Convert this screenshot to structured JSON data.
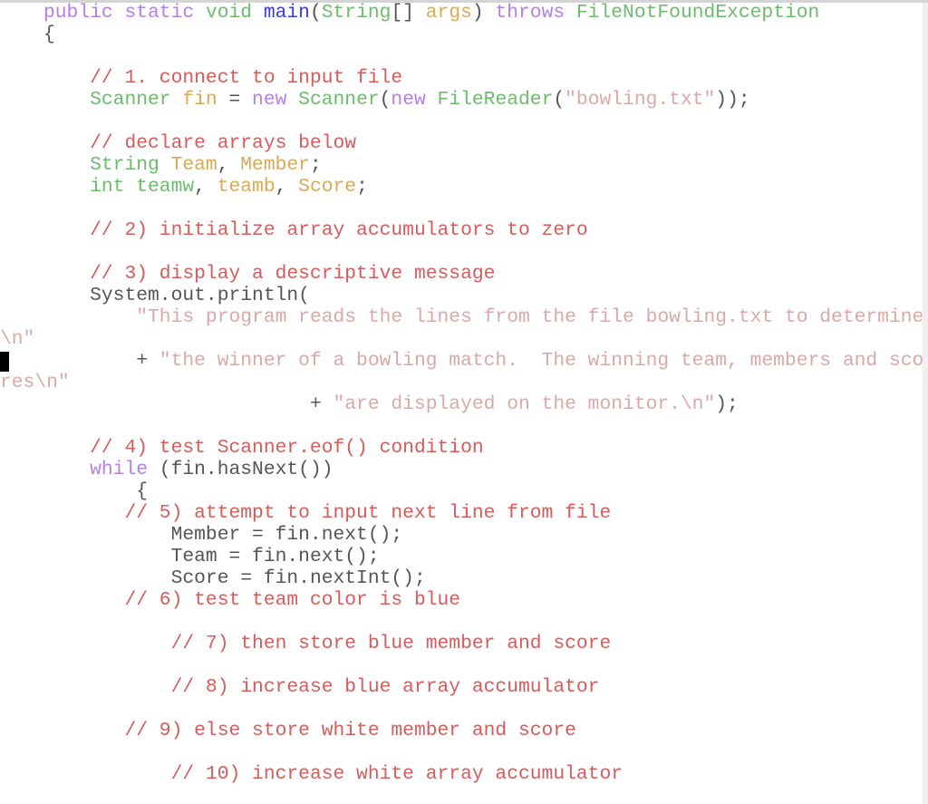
{
  "colors": {
    "keyword": "#b77fe6",
    "type": "#6dbb6d",
    "identifier": "#d8aa55",
    "method": "#3a3ae6",
    "comment": "#d65c5c",
    "string": "#d9a9a9",
    "plain": "#555555"
  },
  "code_lines": [
    {
      "indent": 0,
      "tokens": [
        [
          "public static ",
          "kw"
        ],
        [
          "void ",
          "ty"
        ],
        [
          "main",
          "fn"
        ],
        [
          "(",
          "pl"
        ],
        [
          "String",
          "ty"
        ],
        [
          "[] ",
          "pl"
        ],
        [
          "args",
          "id"
        ],
        [
          ") ",
          "pl"
        ],
        [
          "throws ",
          "kw"
        ],
        [
          "FileNotFoundException",
          "ty"
        ]
      ]
    },
    {
      "indent": 0,
      "tokens": [
        [
          "{",
          "pl"
        ]
      ]
    },
    {
      "indent": 4,
      "tokens": [
        [
          "// 1. connect to input file",
          "cm"
        ]
      ]
    },
    {
      "indent": 4,
      "tokens": [
        [
          "Scanner ",
          "ty"
        ],
        [
          "fin",
          "id"
        ],
        [
          " = ",
          "pl"
        ],
        [
          "new ",
          "kw"
        ],
        [
          "Scanner",
          "ty"
        ],
        [
          "(",
          "pl"
        ],
        [
          "new ",
          "kw"
        ],
        [
          "FileReader",
          "ty"
        ],
        [
          "(",
          "pl"
        ],
        [
          "\"bowling.txt\"",
          "st"
        ],
        [
          "));",
          "pl"
        ]
      ]
    },
    {
      "indent": 4,
      "tokens": [
        [
          "// declare arrays below",
          "cm"
        ]
      ]
    },
    {
      "indent": 4,
      "tokens": [
        [
          "String ",
          "ty"
        ],
        [
          "Team",
          "id"
        ],
        [
          ", ",
          "pl"
        ],
        [
          "Member",
          "id"
        ],
        [
          ";",
          "pl"
        ]
      ]
    },
    {
      "indent": 4,
      "tokens": [
        [
          "int ",
          "ty"
        ],
        [
          "teamw",
          "ty"
        ],
        [
          ", ",
          "pl"
        ],
        [
          "teamb",
          "id"
        ],
        [
          ", ",
          "pl"
        ],
        [
          "Score",
          "id"
        ],
        [
          ";",
          "pl"
        ]
      ]
    },
    {
      "indent": 4,
      "tokens": [
        [
          "// 2) initialize array accumulators to zero",
          "cm"
        ]
      ]
    },
    {
      "indent": 4,
      "tokens": [
        [
          "// 3) display a descriptive message",
          "cm"
        ]
      ]
    },
    {
      "indent": 4,
      "tokens": [
        [
          "System.out.println(",
          "pl"
        ]
      ]
    },
    {
      "indent": 8,
      "tokens": [
        [
          "\"This program reads the lines from the file bowling.txt to determine",
          "st"
        ]
      ]
    },
    {
      "indent": -4,
      "tokens": [
        [
          "\\n\"",
          "st"
        ]
      ]
    },
    {
      "indent": 8,
      "tokens": [
        [
          "+ ",
          "pl"
        ],
        [
          "\"the winner of a bowling match.  The winning team, members and sco",
          "st"
        ]
      ]
    },
    {
      "indent": -4,
      "tokens": [
        [
          "res\\n\"",
          "st"
        ]
      ]
    },
    {
      "indent": 23,
      "tokens": [
        [
          "+ ",
          "pl"
        ],
        [
          "\"are displayed on the monitor.\\n\"",
          "st"
        ],
        [
          ");",
          "pl"
        ]
      ]
    },
    {
      "indent": 4,
      "tokens": [
        [
          "// 4) test Scanner.eof() condition",
          "cm"
        ]
      ]
    },
    {
      "indent": 4,
      "tokens": [
        [
          "while ",
          "kw"
        ],
        [
          "(fin.hasNext())",
          "pl"
        ]
      ]
    },
    {
      "indent": 8,
      "tokens": [
        [
          "{",
          "pl"
        ]
      ]
    },
    {
      "indent": 7,
      "tokens": [
        [
          "// 5) attempt to input next line from file",
          "cm"
        ]
      ]
    },
    {
      "indent": 11,
      "tokens": [
        [
          "Member = fin.next();",
          "pl"
        ]
      ]
    },
    {
      "indent": 11,
      "tokens": [
        [
          "Team = fin.next();",
          "pl"
        ]
      ]
    },
    {
      "indent": 11,
      "tokens": [
        [
          "Score = fin.nextInt();",
          "pl"
        ]
      ]
    },
    {
      "indent": 7,
      "tokens": [
        [
          "// 6) test team color is blue",
          "cm"
        ]
      ]
    },
    {
      "indent": 11,
      "tokens": [
        [
          "// 7) then store blue member and score",
          "cm"
        ]
      ]
    },
    {
      "indent": 11,
      "tokens": [
        [
          "// 8) increase blue array accumulator",
          "cm"
        ]
      ]
    },
    {
      "indent": 7,
      "tokens": [
        [
          "// 9) else store white member and score",
          "cm"
        ]
      ]
    },
    {
      "indent": 11,
      "tokens": [
        [
          "// 10) increase white array accumulator",
          "cm"
        ]
      ]
    }
  ]
}
